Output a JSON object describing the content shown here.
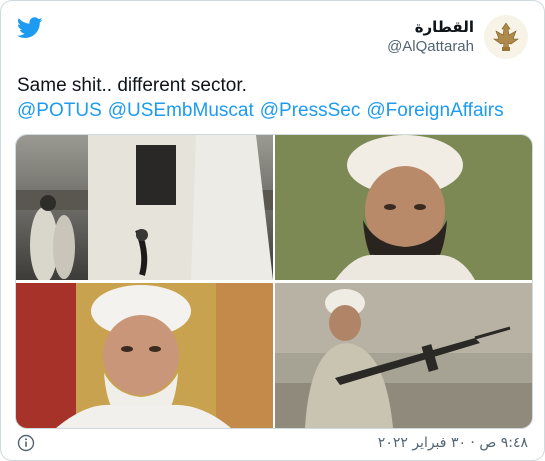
{
  "colors": {
    "twitter_blue": "#1d9bf0",
    "text": "#0f1419",
    "muted": "#536471",
    "border": "#cfd9de"
  },
  "header": {
    "logo_icon": "twitter-bird-icon",
    "display_name": "القطارة",
    "handle": "@AlQattarah",
    "avatar_icon": "falcon-emblem-icon"
  },
  "tweet": {
    "text": "Same shit.. different sector.",
    "mentions": [
      "@POTUS",
      "@USEmbMuscat",
      "@PressSec",
      "@ForeignAffairs"
    ]
  },
  "photos": [
    {
      "name": "photo-top-left"
    },
    {
      "name": "photo-top-right"
    },
    {
      "name": "photo-bottom-left"
    },
    {
      "name": "photo-bottom-right"
    }
  ],
  "footer": {
    "info_icon": "info-icon",
    "timestamp": "٩:٤٨ ص · ٣٠ فبراير ٢٠٢٢"
  }
}
